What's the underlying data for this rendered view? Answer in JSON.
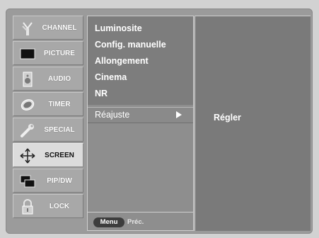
{
  "nav": {
    "items": [
      {
        "label": "CHANNEL",
        "icon": "antenna-icon"
      },
      {
        "label": "PICTURE",
        "icon": "monitor-icon"
      },
      {
        "label": "AUDIO",
        "icon": "speaker-icon"
      },
      {
        "label": "TIMER",
        "icon": "clock-icon"
      },
      {
        "label": "SPECIAL",
        "icon": "wrench-icon"
      },
      {
        "label": "SCREEN",
        "icon": "move-arrows-icon"
      },
      {
        "label": "PIP/DW",
        "icon": "pip-windows-icon"
      },
      {
        "label": "LOCK",
        "icon": "padlock-icon"
      }
    ],
    "active": "SCREEN"
  },
  "submenu": {
    "options": [
      "Luminosite",
      "Config. manuelle",
      "Allongement",
      "Cinema",
      "NR"
    ],
    "selected": "Réajuste",
    "selected_arrow": "▶"
  },
  "detail": {
    "action": "Régler"
  },
  "footer": {
    "menu_label": "Menu",
    "prev_label": "Préc."
  },
  "colors": {
    "panel": "#9b9b9b",
    "active_nav": "#dcdcdc",
    "text": "#ffffff"
  }
}
